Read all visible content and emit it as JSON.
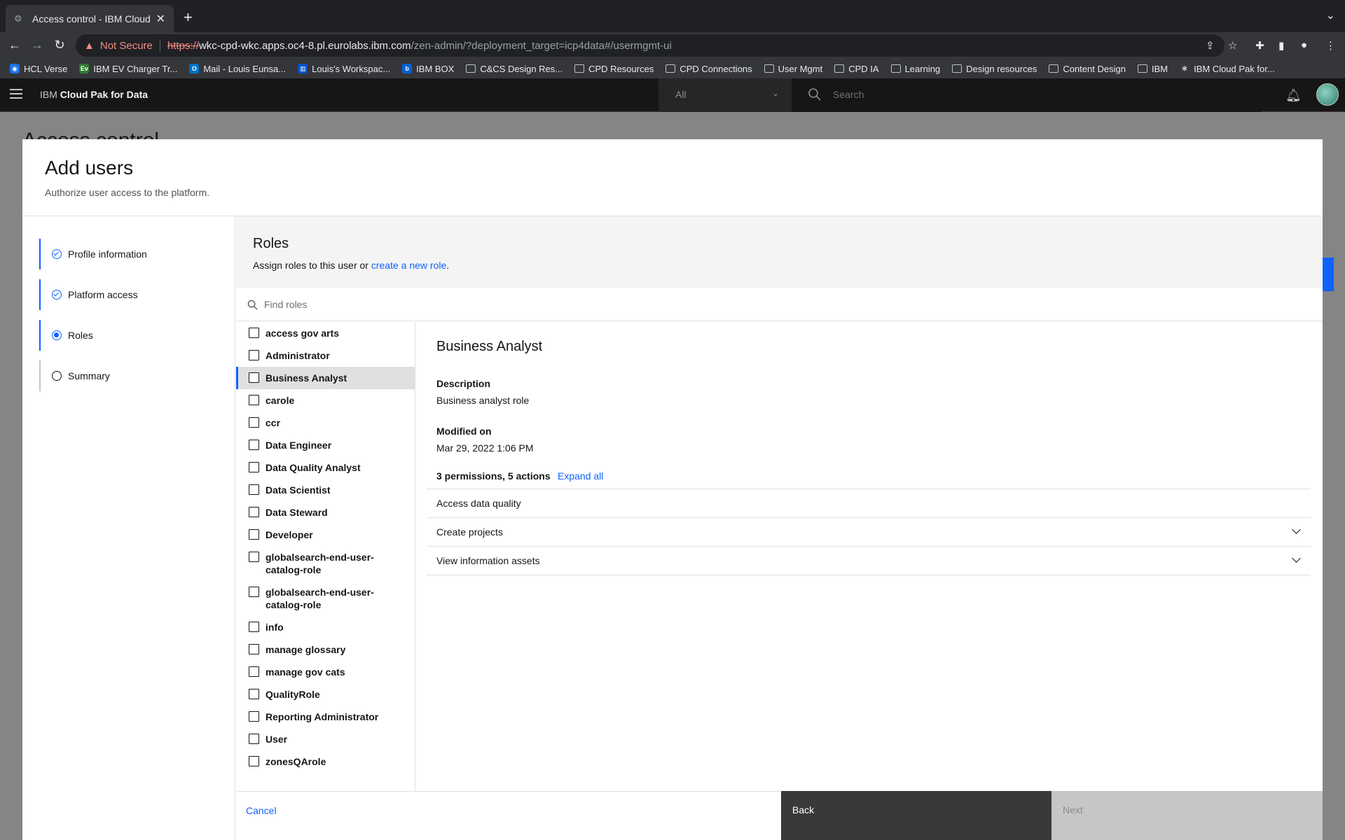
{
  "browser": {
    "tab_title": "Access control - IBM Cloud Pak for Data",
    "not_secure": "Not Secure",
    "url_scheme": "https://",
    "url_host": "wkc-cpd-wkc.apps.oc4-8.pl.eurolabs.ibm.com",
    "url_path": "/zen-admin/?deployment_target=icp4data#/usermgmt-ui",
    "bookmarks": [
      "HCL Verse",
      "IBM EV Charger Tr...",
      "Mail - Louis Eunsa...",
      "Louis's Workspac...",
      "IBM BOX",
      "C&CS Design Res...",
      "CPD Resources",
      "CPD Connections",
      "User Mgmt",
      "CPD IA",
      "Learning",
      "Design resources",
      "Content Design",
      "IBM",
      "IBM Cloud Pak for..."
    ]
  },
  "app": {
    "brand_prefix": "IBM",
    "brand_name": "Cloud Pak for Data",
    "scope_select": "All",
    "search_placeholder": "Search",
    "bg_page_title": "Access control"
  },
  "modal": {
    "title": "Add users",
    "subtitle": "Authorize user access to the platform.",
    "steps": [
      {
        "label": "Profile information",
        "state": "complete"
      },
      {
        "label": "Platform access",
        "state": "complete"
      },
      {
        "label": "Roles",
        "state": "current"
      },
      {
        "label": "Summary",
        "state": "incomplete"
      }
    ],
    "roles": {
      "title": "Roles",
      "desc_prefix": "Assign roles to this user or ",
      "desc_link": "create a new role",
      "desc_suffix": ".",
      "find_placeholder": "Find roles",
      "list": [
        "access gov arts",
        "Administrator",
        "Business Analyst",
        "carole",
        "ccr",
        "Data Engineer",
        "Data Quality Analyst",
        "Data Scientist",
        "Data Steward",
        "Developer",
        "globalsearch-end-user-catalog-role",
        "globalsearch-end-user-catalog-role",
        "info",
        "manage glossary",
        "manage gov cats",
        "QualityRole",
        "Reporting Administrator",
        "User",
        "zonesQArole"
      ],
      "selected_index": 2
    },
    "detail": {
      "title": "Business Analyst",
      "description_label": "Description",
      "description": "Business analyst role",
      "modified_label": "Modified on",
      "modified": "Mar 29, 2022 1:06 PM",
      "perm_summary": "3 permissions, 5 actions",
      "expand_all": "Expand all",
      "permissions": [
        {
          "label": "Access data quality",
          "expandable": false
        },
        {
          "label": "Create projects",
          "expandable": true
        },
        {
          "label": "View information assets",
          "expandable": true
        }
      ]
    },
    "footer": {
      "cancel": "Cancel",
      "back": "Back",
      "next": "Next"
    }
  }
}
